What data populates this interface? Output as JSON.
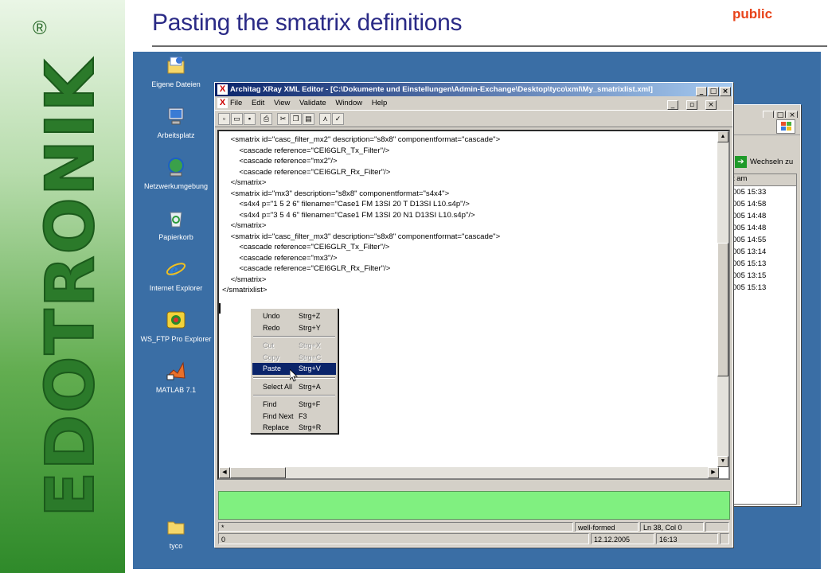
{
  "slide": {
    "title": "Pasting the smatrix definitions",
    "classification": "public",
    "brand_text": "EDOTRONIK",
    "registered_mark": "®"
  },
  "desktop": {
    "icons": [
      {
        "label": "Eigene Dateien",
        "icon": "folder-docs-icon"
      },
      {
        "label": "Arbeitsplatz",
        "icon": "computer-icon"
      },
      {
        "label": "Netzwerkumgebung",
        "icon": "network-icon"
      },
      {
        "label": "Papierkorb",
        "icon": "recycle-bin-icon"
      },
      {
        "label": "Internet Explorer",
        "icon": "ie-icon"
      },
      {
        "label": "WS_FTP Pro Explorer",
        "icon": "ftp-icon"
      },
      {
        "label": "MATLAB 7.1",
        "icon": "matlab-icon"
      },
      {
        "label": "tyco",
        "icon": "folder-icon"
      }
    ]
  },
  "background_window": {
    "go_label": "Wechseln zu",
    "column_header": "t am",
    "rows": [
      "005 15:33",
      "005 14:58",
      "005 14:48",
      "005 14:48",
      "005 14:55",
      "005 13:14",
      "005 15:13",
      "005 13:15",
      "005 15:13"
    ]
  },
  "editor_window": {
    "title": "Architag XRay XML Editor - [C:\\Dokumente und Einstellungen\\Admin-Exchange\\Desktop\\tyco\\xml\\My_smatrixlist.xml]",
    "menu": [
      "File",
      "Edit",
      "View",
      "Validate",
      "Window",
      "Help"
    ],
    "code_lines": [
      "    <smatrix id=\"casc_filter_mx2\" description=\"s8x8\" componentformat=\"cascade\">",
      "        <cascade reference=\"CEI6GLR_Tx_Filter\"/>",
      "        <cascade reference=\"mx2\"/>",
      "        <cascade reference=\"CEI6GLR_Rx_Filter\"/>",
      "    </smatrix>",
      "    <smatrix id=\"mx3\" description=\"s8x8\" componentformat=\"s4x4\">",
      "        <s4x4 p=\"1 5 2 6\" filename=\"Case1 FM 13SI 20 T D13SI L10.s4p\"/>",
      "        <s4x4 p=\"3 5 4 6\" filename=\"Case1 FM 13SI 20 N1 D13SI L10.s4p\"/>",
      "    </smatrix>",
      "    <smatrix id=\"casc_filter_mx3\" description=\"s8x8\" componentformat=\"cascade\">",
      "        <cascade reference=\"CEI6GLR_Tx_Filter\"/>",
      "        <cascade reference=\"mx3\"/>",
      "        <cascade reference=\"CEI6GLR_Rx_Filter\"/>",
      "    </smatrix>",
      "</smatrixlist>"
    ],
    "status": {
      "left": "*",
      "wellformed": "well-formed",
      "position": "Ln 38, Col 0",
      "count": "0",
      "date": "12.12.2005",
      "time": "16:13"
    }
  },
  "context_menu": {
    "items": [
      {
        "label": "Undo",
        "shortcut": "Strg+Z",
        "state": "enabled"
      },
      {
        "label": "Redo",
        "shortcut": "Strg+Y",
        "state": "enabled"
      },
      {
        "label": "Cut",
        "shortcut": "Strg+X",
        "state": "disabled"
      },
      {
        "label": "Copy",
        "shortcut": "Strg+C",
        "state": "disabled"
      },
      {
        "label": "Paste",
        "shortcut": "Strg+V",
        "state": "highlighted"
      },
      {
        "label": "Select All",
        "shortcut": "Strg+A",
        "state": "enabled"
      },
      {
        "label": "Find",
        "shortcut": "Strg+F",
        "state": "enabled"
      },
      {
        "label": "Find Next",
        "shortcut": "F3",
        "state": "enabled"
      },
      {
        "label": "Replace",
        "shortcut": "Strg+R",
        "state": "enabled"
      }
    ]
  },
  "colors": {
    "title_blue": "#2a2a86",
    "public_orange": "#e8431a",
    "desktop_blue": "#3a6ea5",
    "editor_status_green": "#80f080",
    "menu_highlight": "#0a246a"
  }
}
